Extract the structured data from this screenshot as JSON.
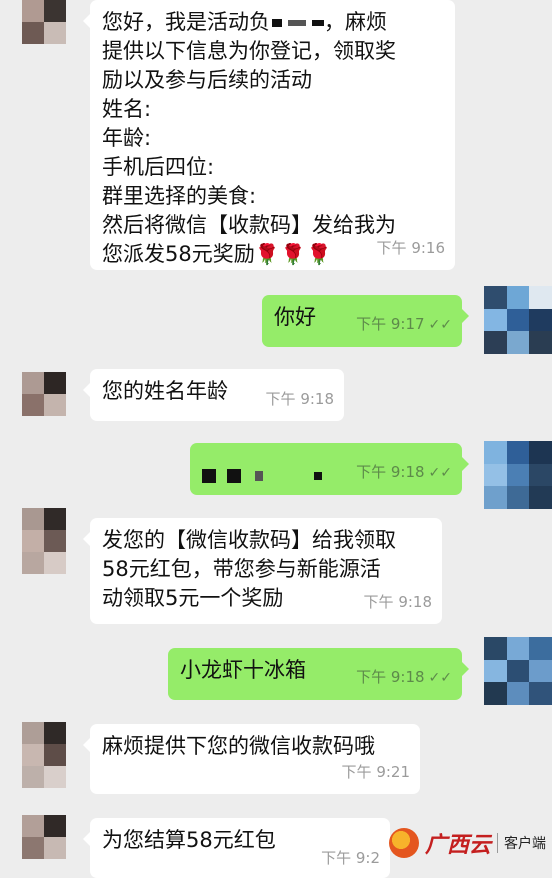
{
  "messages": {
    "m1": {
      "lines": [
        "您好，我是活动负",
        "提供以下信息为你登记，领取奖",
        "励以及参与后续的活动",
        "姓名:",
        "年龄:",
        "手机后四位:",
        "群里选择的美食:",
        "然后将微信【收款码】发给我为",
        "您派发58元奖励"
      ],
      "line1_suffix": "，麻烦",
      "emoji": "🌹🌹🌹",
      "time": "下午 9:16"
    },
    "m2": {
      "text": "你好",
      "time": "下午 9:17",
      "status": "read-ticks"
    },
    "m3": {
      "text": "您的姓名年龄",
      "time": "下午 9:18"
    },
    "m4": {
      "time": "下午 9:18",
      "status": "read-ticks"
    },
    "m5": {
      "lines": [
        "发您的【微信收款码】给我领取",
        "58元红包，带您参与新能源活",
        "动领取5元一个奖励"
      ],
      "time": "下午 9:18"
    },
    "m6": {
      "text": "小龙虾十冰箱",
      "time": "下午 9:18",
      "status": "read-ticks"
    },
    "m7": {
      "text": "麻烦提供下您的微信收款码哦",
      "time": "下午 9:21"
    },
    "m8": {
      "text": "为您结算58元红包",
      "time": "下午 9:2"
    }
  },
  "ticks": "✓✓",
  "watermark": {
    "brand": "广西云",
    "client": "客户端"
  }
}
